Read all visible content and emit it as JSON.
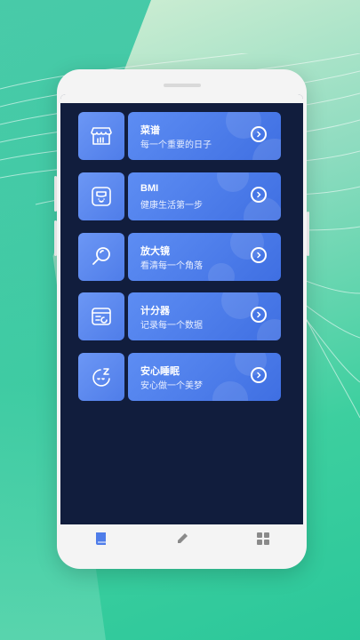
{
  "app": {
    "accent_color": "#4f7de9",
    "screen_bg": "#111d3d"
  },
  "tools": [
    {
      "title": "菜谱",
      "subtitle": "每一个重要的日子",
      "icon": "shop-icon"
    },
    {
      "title": "BMI",
      "subtitle": "健康生活第一步",
      "icon": "scale-icon"
    },
    {
      "title": "放大镜",
      "subtitle": "看清每一个角落",
      "icon": "magnifier-icon"
    },
    {
      "title": "计分器",
      "subtitle": "记录每一个数据",
      "icon": "scoreboard-icon"
    },
    {
      "title": "安心睡眠",
      "subtitle": "安心做一个美梦",
      "icon": "sleep-icon"
    }
  ],
  "nav": [
    {
      "icon": "book-icon",
      "active": true
    },
    {
      "icon": "pencil-icon",
      "active": false
    },
    {
      "icon": "grid-icon",
      "active": false
    }
  ]
}
